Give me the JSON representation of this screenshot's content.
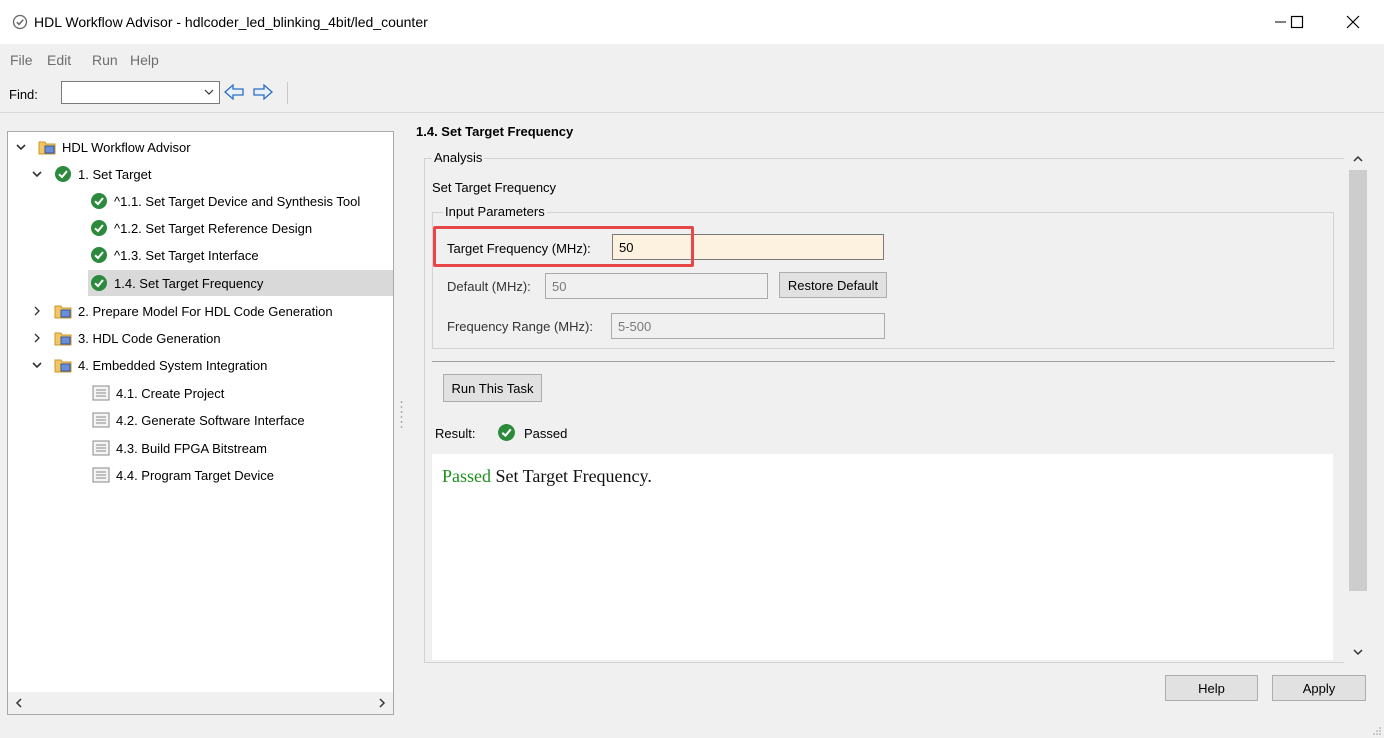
{
  "window": {
    "title": "HDL Workflow Advisor - hdlcoder_led_blinking_4bit/led_counter",
    "minimize_glyph": "—",
    "maximize_glyph": "☐",
    "close_glyph": "✕"
  },
  "menu": {
    "items": [
      "File",
      "Edit",
      "Run",
      "Help"
    ]
  },
  "find": {
    "label": "Find:",
    "value": ""
  },
  "tree": {
    "root": "HDL Workflow Advisor",
    "items": [
      {
        "label": "1. Set Target",
        "icon": "check-icon"
      },
      {
        "label": "^1.1. Set Target Device and Synthesis Tool",
        "icon": "check-icon"
      },
      {
        "label": "^1.2. Set Target Reference Design",
        "icon": "check-icon"
      },
      {
        "label": "^1.3. Set Target Interface",
        "icon": "check-icon"
      },
      {
        "label": "1.4. Set Target Frequency",
        "icon": "check-icon"
      },
      {
        "label": "2. Prepare Model For HDL Code Generation",
        "icon": "folder-icon"
      },
      {
        "label": "3. HDL Code Generation",
        "icon": "folder-icon"
      },
      {
        "label": "4. Embedded System Integration",
        "icon": "folder-icon"
      },
      {
        "label": "4.1. Create Project",
        "icon": "task-icon"
      },
      {
        "label": "4.2. Generate Software Interface",
        "icon": "task-icon"
      },
      {
        "label": "4.3. Build FPGA Bitstream",
        "icon": "task-icon"
      },
      {
        "label": "4.4. Program Target Device",
        "icon": "task-icon"
      }
    ]
  },
  "pane": {
    "title": "1.4. Set Target Frequency",
    "analysis_legend": "Analysis",
    "section_label": "Set Target Frequency",
    "input_legend": "Input Parameters",
    "target_freq_label": "Target Frequency (MHz):",
    "target_freq_value": "50",
    "default_label": "Default (MHz):",
    "default_value": "50",
    "restore_button": "Restore Default",
    "range_label": "Frequency Range (MHz):",
    "range_value": "5-500",
    "run_button": "Run This Task",
    "result_label": "Result:",
    "result_value": "Passed",
    "result_message_status": "Passed",
    "result_message_text": " Set Target Frequency."
  },
  "footer": {
    "help_button": "Help",
    "apply_button": "Apply"
  },
  "colors": {
    "passed_green": "#1d8f1d",
    "highlight_red": "#e8474a",
    "active_field": "#fdf1e0"
  }
}
